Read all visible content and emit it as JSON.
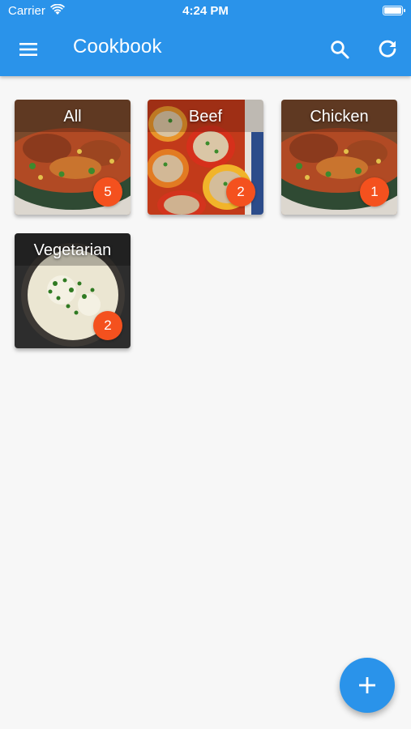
{
  "status_bar": {
    "carrier": "Carrier",
    "time": "4:24 PM"
  },
  "app_bar": {
    "title": "Cookbook",
    "icons": [
      "menu-icon",
      "search-icon",
      "refresh-icon"
    ]
  },
  "categories": [
    {
      "label": "All",
      "count": "5",
      "image": "skillet-dish"
    },
    {
      "label": "Beef",
      "count": "2",
      "image": "stuffed-peppers"
    },
    {
      "label": "Chicken",
      "count": "1",
      "image": "skillet-dish"
    },
    {
      "label": "Vegetarian",
      "count": "2",
      "image": "risotto-bowl"
    }
  ],
  "fab": {
    "icon": "add-icon"
  },
  "colors": {
    "primary": "#2a93ea",
    "badge": "#f4511e",
    "background": "#f7f7f7"
  }
}
